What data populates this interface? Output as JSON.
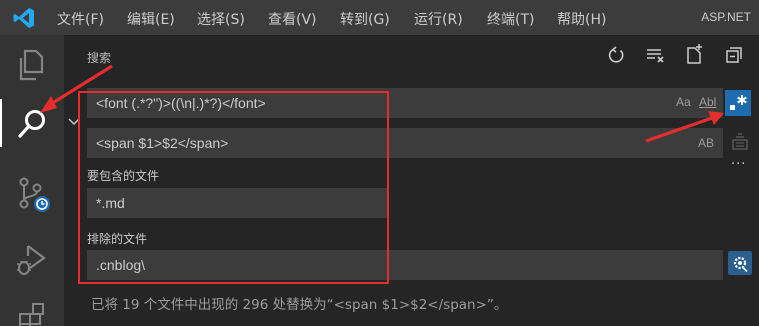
{
  "titlebar": {
    "menus": [
      "文件(F)",
      "编辑(E)",
      "选择(S)",
      "查看(V)",
      "转到(G)",
      "运行(R)",
      "终端(T)",
      "帮助(H)"
    ],
    "app_name": "ASP.NET"
  },
  "activitybar": {
    "items": [
      "explorer-icon",
      "search-icon",
      "source-control-icon",
      "run-debug-icon",
      "extensions-icon"
    ]
  },
  "search": {
    "title": "搜索",
    "find_value": "<font (.*?\")>((\\n|.)*?)</font>",
    "replace_value": "<span $1>$2</span>",
    "include_label": "要包含的文件",
    "include_value": "*.md",
    "exclude_label": "排除的文件",
    "exclude_value": ".cnblog\\",
    "match_case_label": "Aa",
    "whole_word_label": "Abl",
    "preserve_case_label": "AB",
    "more_label": "···",
    "result_message": "已将 19 个文件中出现的 296 处替换为“<span $1>$2</span>”。"
  },
  "colors": {
    "accent": "#007acc",
    "annotation": "#e52d2d",
    "regex_active": "#1e6bb0"
  }
}
